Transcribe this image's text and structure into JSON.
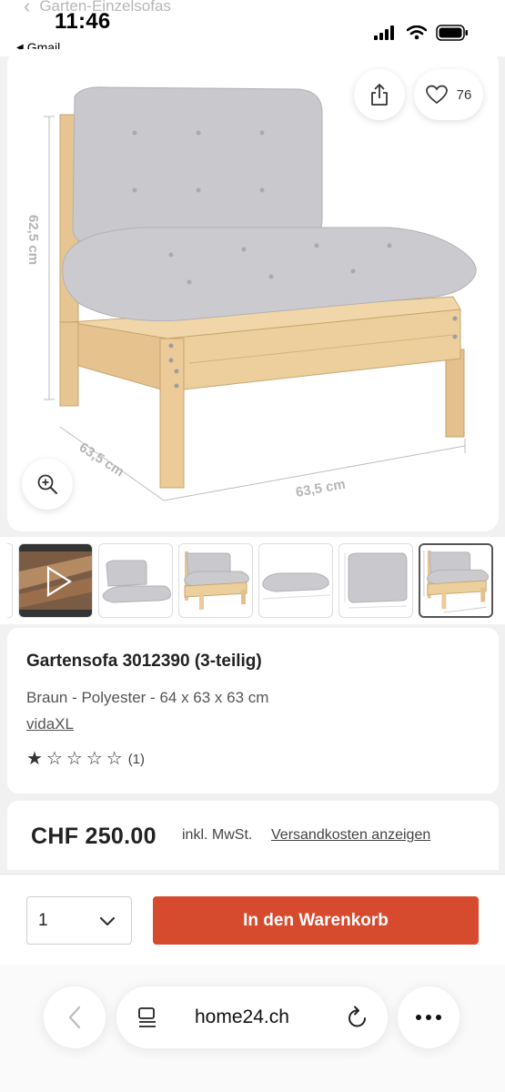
{
  "status_bar": {
    "time": "11:46",
    "back_app": "Gmail",
    "nav_back_label": "Garten-Einzelsofas"
  },
  "gallery": {
    "favorites_count": "76",
    "dimension_labels": {
      "height": "62,5 cm",
      "depth": "63,5 cm",
      "width": "63,5 cm"
    },
    "thumbnails": [
      "video",
      "cushion-set",
      "sofa-front",
      "seat-cushion",
      "back-cushion-dim",
      "sofa-dim"
    ],
    "active_thumbnail": 5
  },
  "product": {
    "title": "Gartensofa 3012390 (3-teilig)",
    "subtitle": "Braun - Polyester - 64 x 63 x 63 cm",
    "brand": "vidaXL",
    "rating": 1,
    "rating_max": 5,
    "rating_count": "(1)"
  },
  "price": {
    "amount": "CHF 250.00",
    "tax_note": "inkl. MwSt.",
    "shipping_link": "Versandkosten anzeigen"
  },
  "cart": {
    "quantity": "1",
    "add_button": "In den Warenkorb"
  },
  "browser": {
    "url": "home24.ch"
  },
  "colors": {
    "accent": "#d64a2e",
    "cushion": "#c9c9cd",
    "wood": "#e8c796"
  }
}
